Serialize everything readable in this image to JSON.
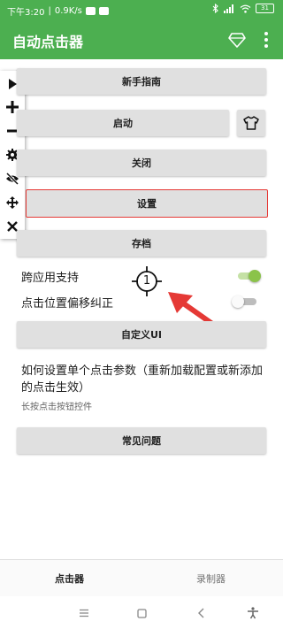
{
  "status_bar": {
    "time": "下午3:20",
    "speed": "0.9K/s",
    "battery": "31"
  },
  "app_bar": {
    "title": "自动点击器",
    "icons": [
      "diamond-icon",
      "more-vert-icon"
    ]
  },
  "floating_toolbar": {
    "icons": [
      "play-icon",
      "plus-icon",
      "minus-icon",
      "gear-icon",
      "eye-off-icon",
      "move-icon",
      "close-icon"
    ]
  },
  "buttons": {
    "guide": "新手指南",
    "start": "启动",
    "close": "关闭",
    "settings": "设置",
    "save": "存档",
    "custom_ui": "自定义UI",
    "faq": "常见问题"
  },
  "toggles": {
    "cross_app_label": "跨应用支持",
    "cross_app_on": true,
    "offset_label": "点击位置偏移纠正",
    "offset_on": false
  },
  "target": {
    "number": "1"
  },
  "info": {
    "title": "如何设置单个点击参数（重新加载配置或新添加的点击生效）",
    "subtitle": "长按点击按钮控件"
  },
  "bottom_nav": {
    "tabs": [
      "点击器",
      "录制器"
    ],
    "active": 0
  },
  "colors": {
    "primary": "#4caf50",
    "accent_red": "#e53935",
    "toggle_on": "#8bc34a"
  }
}
